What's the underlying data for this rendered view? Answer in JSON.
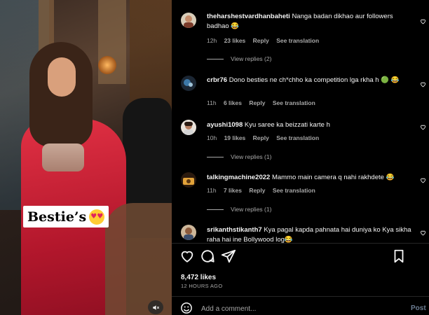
{
  "media": {
    "sticker_text": "Bestie’s",
    "sticker_emoji": "heart-eyes-emoji",
    "mute_icon": "speaker-muted-icon"
  },
  "comments": [
    {
      "username": "theharshestvardhanbaheti",
      "text": "Nanga badan dikhao aur followers badhao 😂",
      "age": "12h",
      "likes": "23 likes",
      "reply": "Reply",
      "see_translation": "See translation",
      "view_replies": "View replies (2)"
    },
    {
      "username": "crbr76",
      "text": "Dono besties ne ch*chho ka competition lga rkha h 🟢 😂",
      "age": "11h",
      "likes": "6 likes",
      "reply": "Reply",
      "see_translation": "See translation",
      "view_replies": ""
    },
    {
      "username": "ayushi1098",
      "text": "Kyu saree ka beizzati karte h",
      "age": "10h",
      "likes": "19 likes",
      "reply": "Reply",
      "see_translation": "See translation",
      "view_replies": "View replies (1)"
    },
    {
      "username": "talkingmachine2022",
      "text": "Mammo main camera q nahi rakhdete 😂",
      "age": "11h",
      "likes": "7 likes",
      "reply": "Reply",
      "see_translation": "See translation",
      "view_replies": "View replies (1)"
    },
    {
      "username": "srikanthstikanth7",
      "text": "Kya pagal kapda pahnata hai duniya ko Kya sikha raha hai ine Bollywood log😂",
      "age": "",
      "likes": "",
      "reply": "",
      "see_translation": "",
      "view_replies": ""
    }
  ],
  "footer": {
    "likes_count": "8,472 likes",
    "timestamp": "12 HOURS AGO",
    "add_comment_placeholder": "Add a comment...",
    "post_label": "Post"
  },
  "colors": {
    "background": "#000000",
    "text_primary": "#f5f5f5",
    "text_secondary": "#a8a8a8",
    "dress_red": "#e23144",
    "post_disabled": "#6c7d92"
  }
}
